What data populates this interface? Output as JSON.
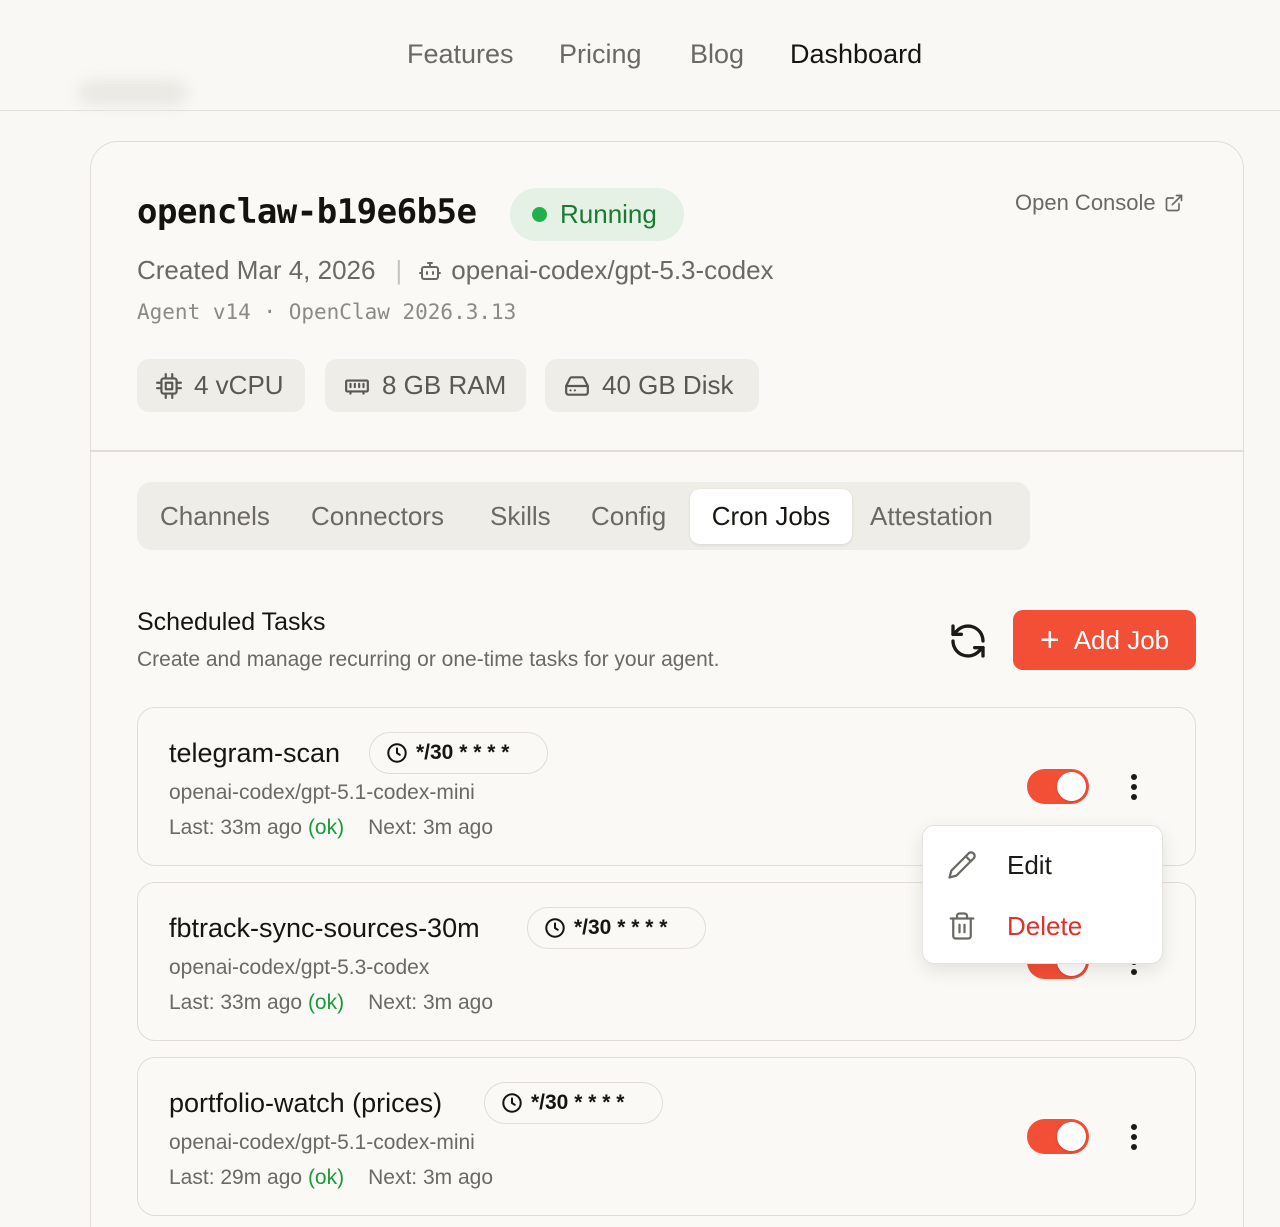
{
  "nav": {
    "links": [
      {
        "label": "Features"
      },
      {
        "label": "Pricing"
      },
      {
        "label": "Blog"
      },
      {
        "label": "Dashboard",
        "active": true
      }
    ]
  },
  "instance": {
    "name": "openclaw-b19e6b5e",
    "status": "Running",
    "status_color": "#1fb24b",
    "open_console": "Open Console",
    "created": "Created Mar 4, 2026",
    "model": "openai-codex/gpt-5.3-codex",
    "version": "Agent v14 · OpenClaw 2026.3.13",
    "specs": {
      "cpu": "4 vCPU",
      "ram": "8 GB RAM",
      "disk": "40 GB Disk"
    }
  },
  "tabs": [
    {
      "label": "Channels"
    },
    {
      "label": "Connectors"
    },
    {
      "label": "Skills"
    },
    {
      "label": "Config"
    },
    {
      "label": "Cron Jobs",
      "active": true
    },
    {
      "label": "Attestation"
    }
  ],
  "scheduled": {
    "title": "Scheduled Tasks",
    "subtitle": "Create and manage recurring or one-time tasks for your agent.",
    "add_button": "Add Job",
    "accent": "#f34e36"
  },
  "jobs": [
    {
      "name": "telegram-scan",
      "schedule": "*/30 * * * *",
      "model": "openai-codex/gpt-5.1-codex-mini",
      "last": "Last: 33m ago",
      "status": "(ok)",
      "next": "Next: 3m ago",
      "enabled": true
    },
    {
      "name": "fbtrack-sync-sources-30m",
      "schedule": "*/30 * * * *",
      "model": "openai-codex/gpt-5.3-codex",
      "last": "Last: 33m ago",
      "status": "(ok)",
      "next": "Next: 3m ago",
      "enabled": true
    },
    {
      "name": "portfolio-watch (prices)",
      "schedule": "*/30 * * * *",
      "model": "openai-codex/gpt-5.1-codex-mini",
      "last": "Last: 29m ago",
      "status": "(ok)",
      "next": "Next: 3m ago",
      "enabled": true
    }
  ],
  "context_menu": {
    "edit": "Edit",
    "delete": "Delete",
    "delete_color": "#e0312a"
  }
}
